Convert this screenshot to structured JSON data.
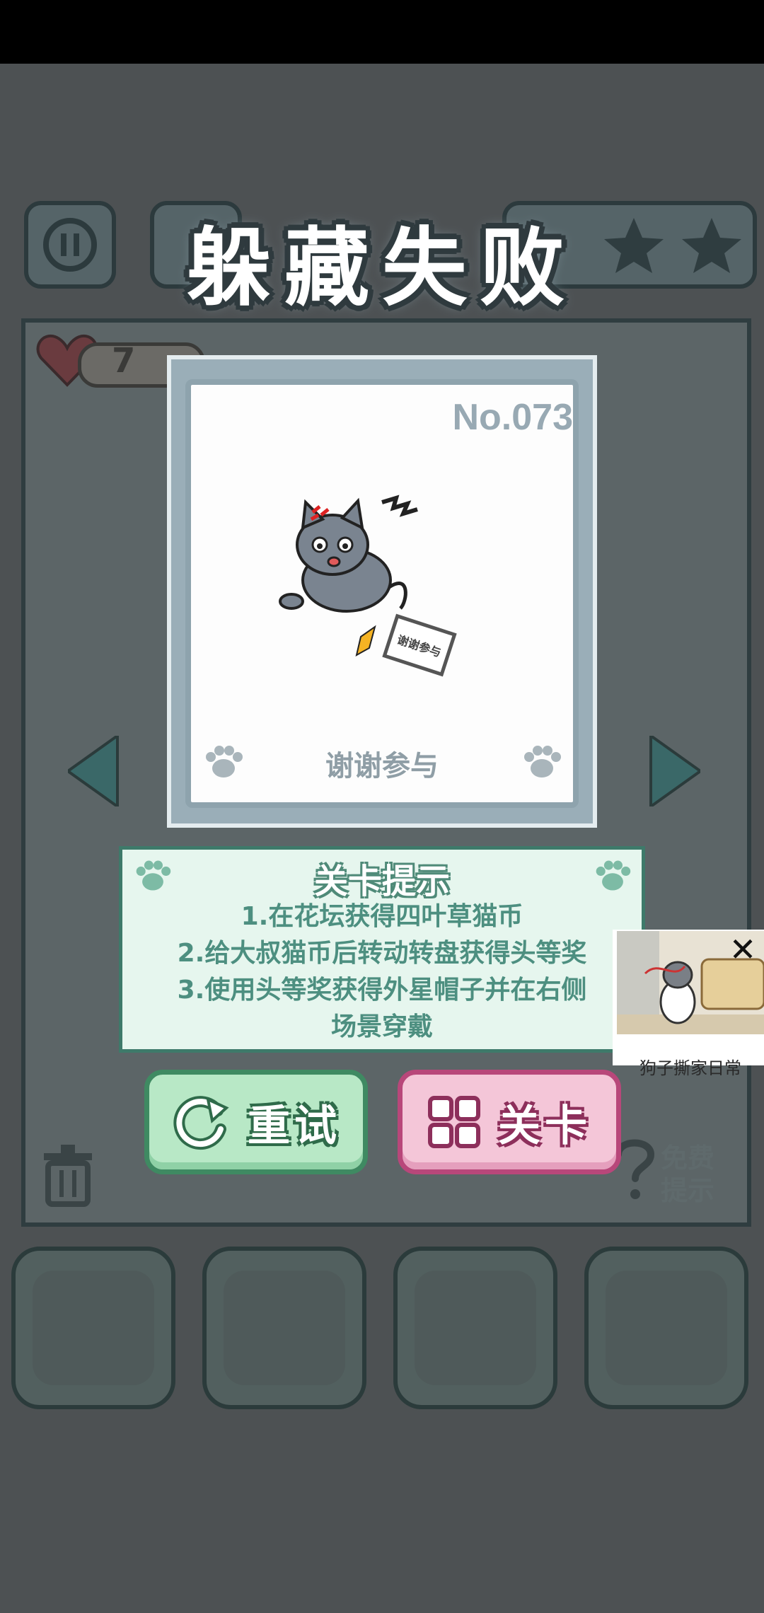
{
  "hud": {
    "lives": "7"
  },
  "result": {
    "title": "躲藏失败"
  },
  "card": {
    "number": "No.073",
    "stamp_text": "谢谢参与",
    "caption": "谢谢参与"
  },
  "hint": {
    "title": "关卡提示",
    "lines": [
      "1.在花坛获得四叶草猫币",
      "2.给大叔猫币后转动转盘获得头等奖",
      "3.使用头等奖获得外星帽子并在右侧",
      "场景穿戴"
    ]
  },
  "buttons": {
    "retry": "重试",
    "levels": "关卡",
    "free_hint": [
      "免费",
      "提示"
    ]
  },
  "ad": {
    "caption": "狗子撕家日常",
    "close_glyph": "✕"
  },
  "colors": {
    "retry_bg": "#b8e8c6",
    "levels_bg": "#f4c6d8",
    "hint_bg": "#e6f6ee",
    "card_frame": "#9aaeb8"
  }
}
